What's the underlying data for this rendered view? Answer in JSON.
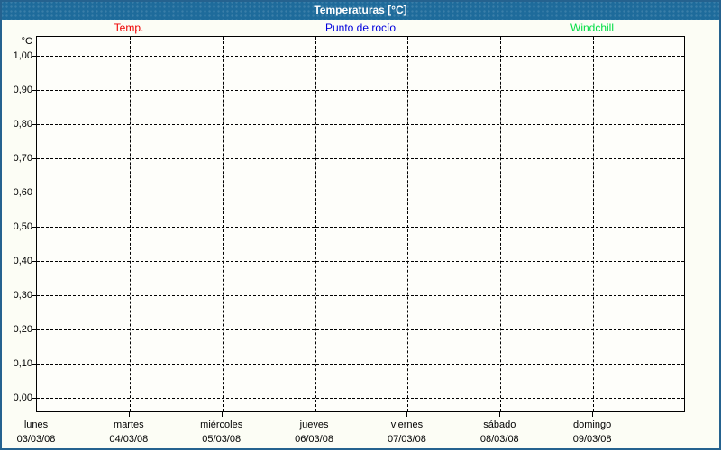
{
  "window": {
    "title": "Temperaturas [°C]"
  },
  "legend": {
    "items": [
      {
        "label": "Temp.",
        "color": "#ee0000"
      },
      {
        "label": "Punto de rocío",
        "color": "#0000dd"
      },
      {
        "label": "Windchill",
        "color": "#00dd44"
      }
    ]
  },
  "chart_data": {
    "type": "line",
    "title": "Temperaturas [°C]",
    "ylabel": "°C",
    "ylim": [
      0.0,
      1.0
    ],
    "y_tick_step": 0.1,
    "y_tick_labels": [
      "1,00",
      "0,90",
      "0,80",
      "0,70",
      "0,60",
      "0,50",
      "0,40",
      "0,30",
      "0,20",
      "0,10",
      "0,00"
    ],
    "x_categories": [
      {
        "day": "lunes",
        "date": "03/03/08"
      },
      {
        "day": "martes",
        "date": "04/03/08"
      },
      {
        "day": "miércoles",
        "date": "05/03/08"
      },
      {
        "day": "jueves",
        "date": "06/03/08"
      },
      {
        "day": "viernes",
        "date": "07/03/08"
      },
      {
        "day": "sábado",
        "date": "08/03/08"
      },
      {
        "day": "domingo",
        "date": "09/03/08"
      }
    ],
    "series": [
      {
        "name": "Temp.",
        "color": "#ee0000",
        "values": []
      },
      {
        "name": "Punto de rocío",
        "color": "#0000dd",
        "values": []
      },
      {
        "name": "Windchill",
        "color": "#00dd44",
        "values": []
      }
    ],
    "grid": "dashed",
    "legend_position": "top",
    "notes": "no data plotted"
  },
  "colors": {
    "titlebar": "#1e6b9b",
    "frame": "#25628f",
    "background": "#fcfdf5",
    "grid": "#000000"
  }
}
